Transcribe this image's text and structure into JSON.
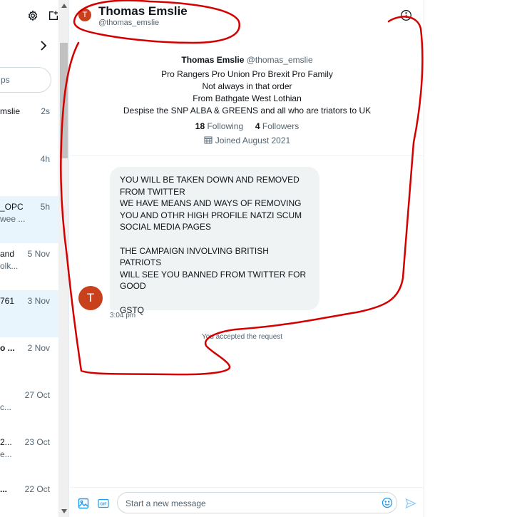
{
  "sidebar": {
    "search_placeholder": "ps",
    "conversations": [
      {
        "name": "mslie",
        "time": "2s",
        "preview": "",
        "bold": false,
        "selected": false
      },
      {
        "name": "",
        "time": "4h",
        "preview": "",
        "bold": false,
        "selected": false
      },
      {
        "name": "_OPC",
        "time": "5h",
        "preview": "wee ...",
        "bold": false,
        "selected": true
      },
      {
        "name": "and",
        "time": "5 Nov",
        "preview": "olk...",
        "bold": false,
        "selected": false
      },
      {
        "name": "761",
        "time": "3 Nov",
        "preview": "",
        "bold": false,
        "selected": true
      },
      {
        "name": "o ...",
        "time": "2 Nov",
        "preview": "",
        "bold": true,
        "selected": false
      },
      {
        "name": "",
        "time": "27 Oct",
        "preview": "c...",
        "bold": false,
        "selected": false
      },
      {
        "name": "2...",
        "time": "23 Oct",
        "preview": "e...",
        "bold": false,
        "selected": false
      },
      {
        "name": "...",
        "time": "22 Oct",
        "preview": "",
        "bold": true,
        "selected": false
      }
    ],
    "icons": [
      "gear-icon",
      "new-message-icon",
      "chevron-right-icon"
    ]
  },
  "header": {
    "avatar_letter": "T",
    "name": "Thomas Emslie",
    "handle": "@thomas_emslie"
  },
  "profile": {
    "name": "Thomas Emslie",
    "handle": "@thomas_emslie",
    "bio_lines": [
      "Pro Rangers Pro Union Pro Brexit Pro Family",
      "Not always in that order",
      "From Bathgate West Lothian",
      "Despise the SNP ALBA & GREENS and all who are triators to UK"
    ],
    "following_count": "18",
    "following_label": "Following",
    "followers_count": "4",
    "followers_label": "Followers",
    "joined": "Joined August 2021"
  },
  "message": {
    "avatar_letter": "T",
    "text": "YOU WILL BE TAKEN DOWN AND REMOVED\nFROM TWITTER\nWE HAVE MEANS AND WAYS OF REMOVING\nYOU AND OTHR HIGH PROFILE NATZI SCUM\nSOCIAL MEDIA PAGES\n\nTHE CAMPAIGN INVOLVING BRITISH PATRIOTS\nWILL SEE YOU BANNED FROM TWITTER FOR\nGOOD\n\nGSTQ",
    "time": "3:04 pm"
  },
  "system_note": "You accepted the request",
  "composer": {
    "placeholder": "Start a new message",
    "icons": [
      "image-icon",
      "gif-icon",
      "emoji-icon",
      "send-icon"
    ]
  },
  "colors": {
    "accent": "#1d9bf0",
    "avatar": "#c8401c",
    "annotation": "#d40000"
  }
}
